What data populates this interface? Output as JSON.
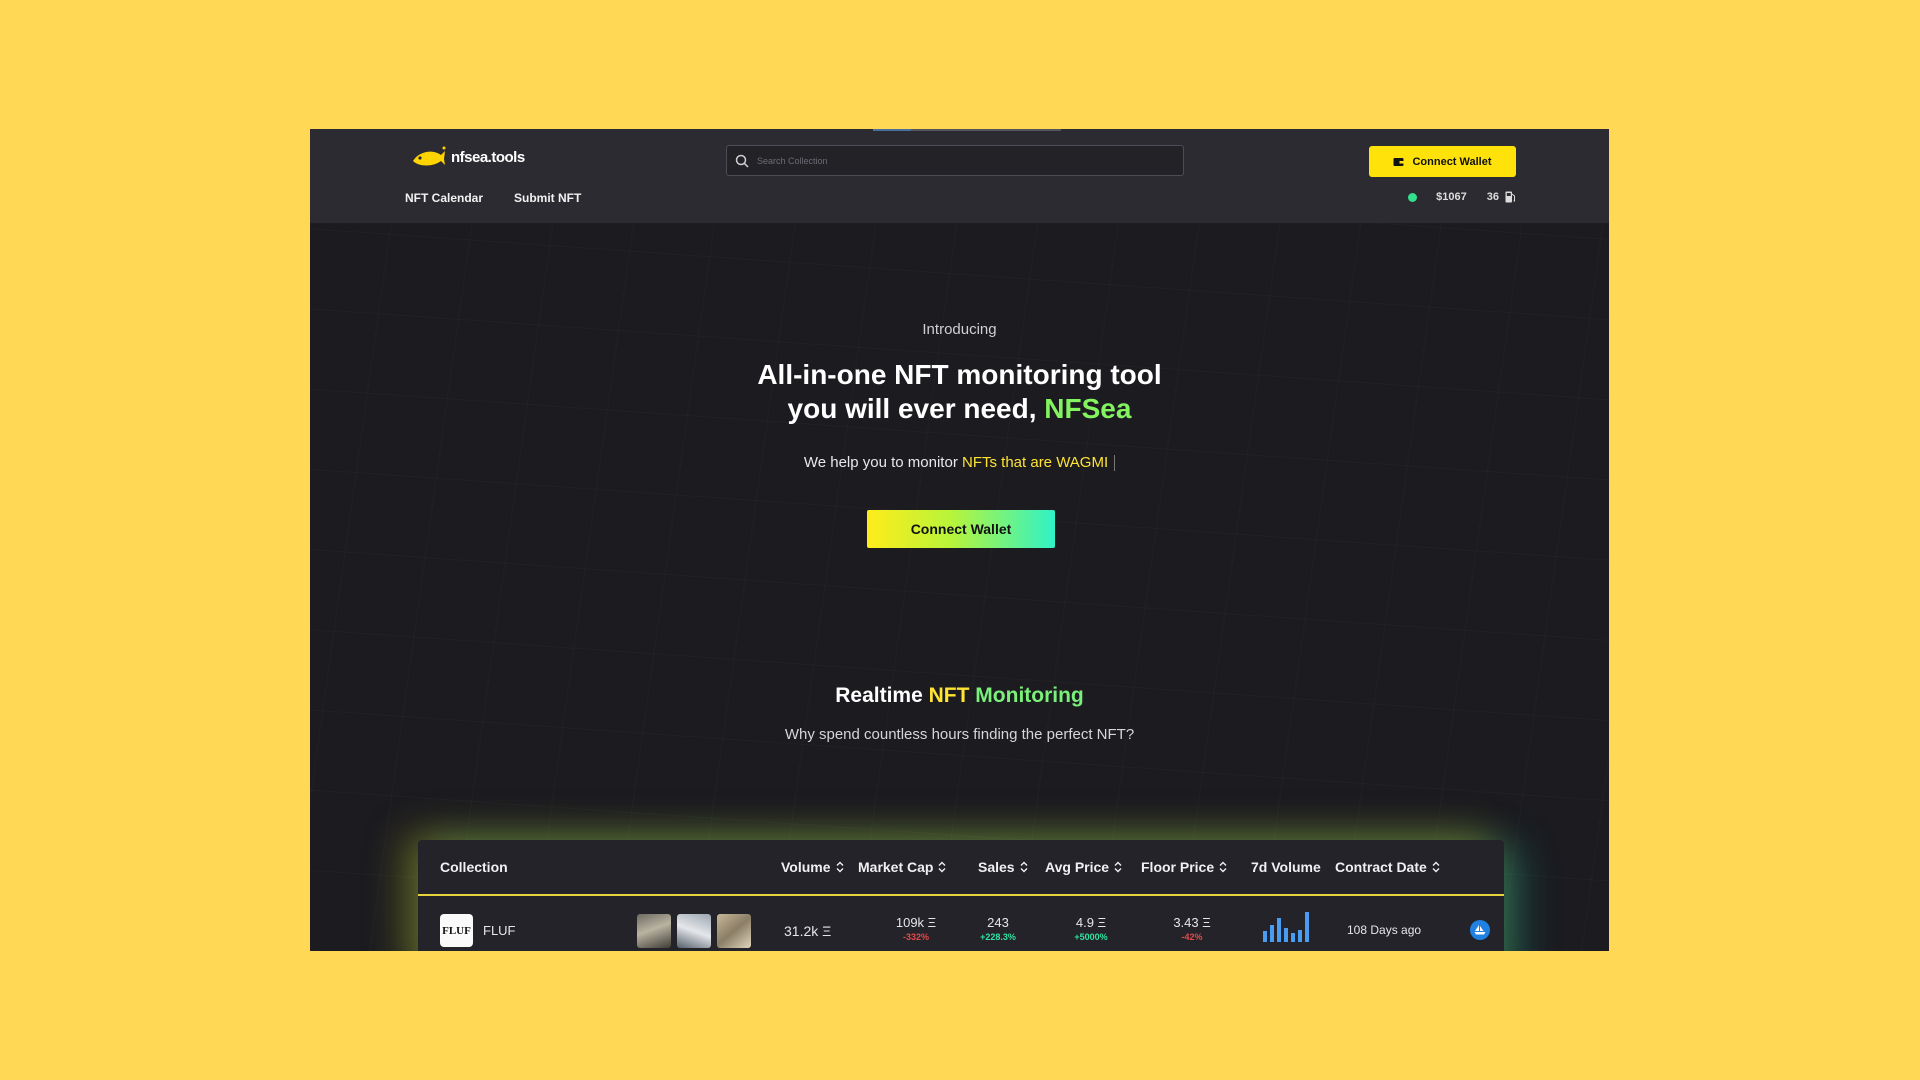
{
  "header": {
    "logo_text": "nfsea.tools",
    "search_placeholder": "Search Collection",
    "connect_label": "Connect Wallet",
    "nav": [
      {
        "label": "NFT Calendar"
      },
      {
        "label": "Submit NFT"
      }
    ],
    "eth_price": "$1067",
    "gas": "36"
  },
  "hero": {
    "intro": "Introducing",
    "headline_line1": "All-in-one NFT monitoring tool",
    "headline_line2": "you will ever need,",
    "headline_accent": "NFSea",
    "sub_prefix": "We help you to monitor",
    "sub_highlight": "NFTs that are WAGMI",
    "cta_label": "Connect Wallet"
  },
  "section": {
    "title_plain": "Realtime",
    "title_nft": "NFT",
    "title_monitoring": "Monitoring",
    "subtitle": "Why spend countless hours finding the perfect NFT?"
  },
  "table": {
    "headers": {
      "collection": "Collection",
      "volume": "Volume",
      "market_cap": "Market Cap",
      "sales": "Sales",
      "avg_price": "Avg Price",
      "floor_price": "Floor Price",
      "volume_7d": "7d Volume",
      "contract_date": "Contract Date"
    },
    "rows": [
      {
        "avatar_text": "FLUF",
        "name": "FLUF",
        "volume": "31.2k Ξ",
        "market_cap": "109k Ξ",
        "market_cap_change": "-332%",
        "sales": "243",
        "sales_change": "+228.3%",
        "avg_price": "4.9 Ξ",
        "avg_price_change": "+5000%",
        "floor_price": "3.43 Ξ",
        "floor_price_change": "-42%",
        "volume_7d_bars": [
          0.35,
          0.55,
          0.8,
          0.45,
          0.3,
          0.4,
          1.0
        ],
        "contract_date": "108 Days ago"
      }
    ]
  },
  "colors": {
    "accent_yellow": "#ffe20a",
    "accent_green": "#83f35f",
    "bar_blue": "#4a9cf0",
    "negative": "#e24b4b",
    "positive": "#2fe3a0"
  }
}
